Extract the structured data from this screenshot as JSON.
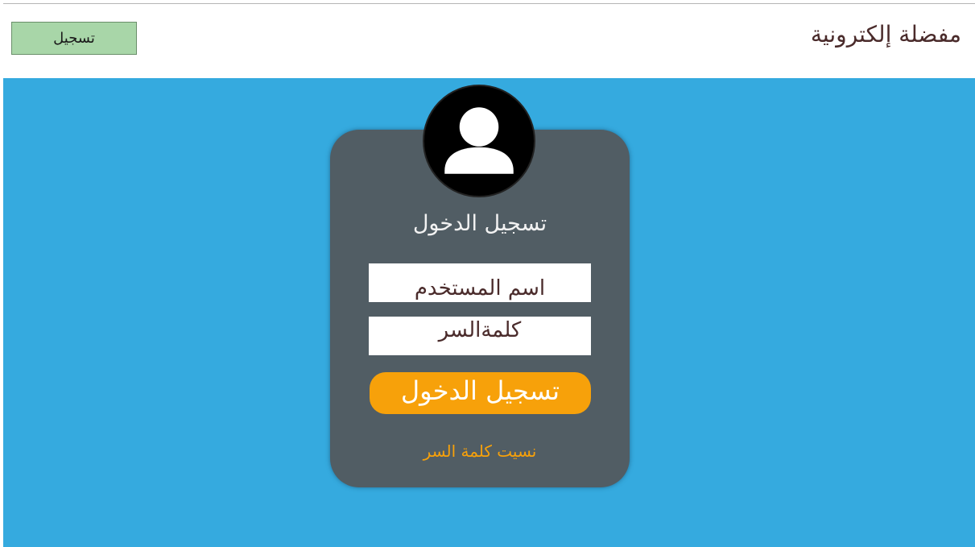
{
  "header": {
    "site_title": "مفضلة إلكترونية",
    "register_label": "تسجيل"
  },
  "login": {
    "title": "تسجيل الدخول",
    "username_placeholder": "اسم المستخدم",
    "password_placeholder": "كلمةالسر",
    "submit_label": "تسجيل الدخول",
    "forgot_label": "نسيت كلمة السر",
    "avatar_icon": "user-avatar-icon"
  },
  "colors": {
    "hero_background": "#35aadf",
    "card_background": "#515d64",
    "accent": "#f7a10a",
    "register_button": "#a8d6a8"
  }
}
